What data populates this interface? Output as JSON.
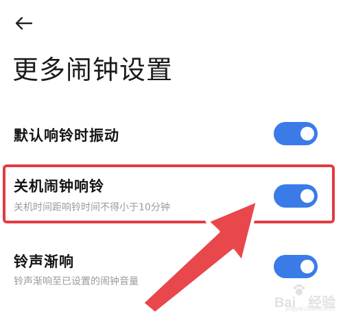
{
  "header": {
    "back_icon": "arrow-left-icon",
    "title": "更多闹钟设置"
  },
  "settings": [
    {
      "label": "默认响铃时振动",
      "sub": "",
      "enabled": true
    },
    {
      "label": "关机闹钟响铃",
      "sub": "关机时间距响铃时间不得小于10分钟",
      "enabled": true
    },
    {
      "label": "铃声渐响",
      "sub": "铃声渐响至已设置的闹钟音量",
      "enabled": true
    }
  ],
  "colors": {
    "toggle_on": "#3a7be8",
    "highlight": "#e23b3f",
    "arrow": "#e8474b"
  },
  "watermark": {
    "logo": "Baidu",
    "label": "经验",
    "url": "jingyan.baidu.com"
  }
}
